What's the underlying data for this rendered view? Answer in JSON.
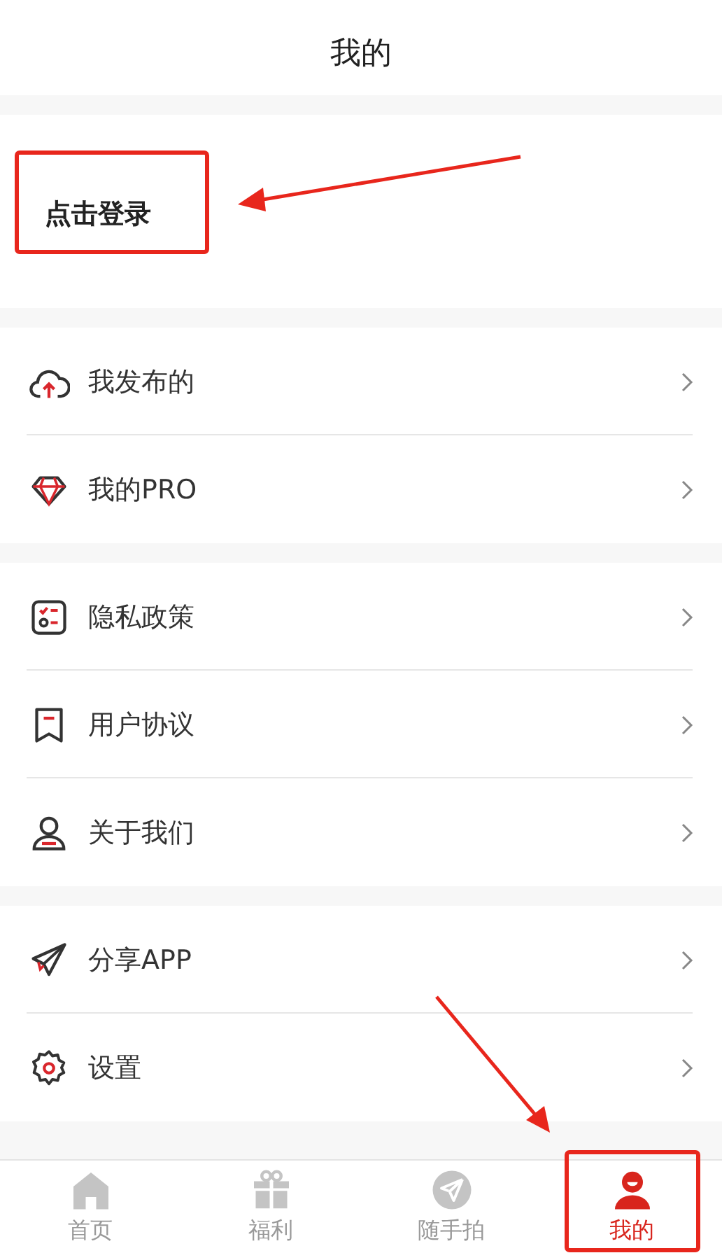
{
  "header": {
    "title": "我的"
  },
  "login": {
    "label": "点击登录"
  },
  "menu_groups": [
    {
      "items": [
        {
          "label": "我发布的"
        },
        {
          "label": "我的PRO"
        }
      ]
    },
    {
      "items": [
        {
          "label": "隐私政策"
        },
        {
          "label": "用户协议"
        },
        {
          "label": "关于我们"
        }
      ]
    },
    {
      "items": [
        {
          "label": "分享APP"
        },
        {
          "label": "设置"
        }
      ]
    }
  ],
  "tabs": [
    {
      "label": "首页",
      "selected": false
    },
    {
      "label": "福利",
      "selected": false
    },
    {
      "label": "随手拍",
      "selected": false
    },
    {
      "label": "我的",
      "selected": true
    }
  ]
}
